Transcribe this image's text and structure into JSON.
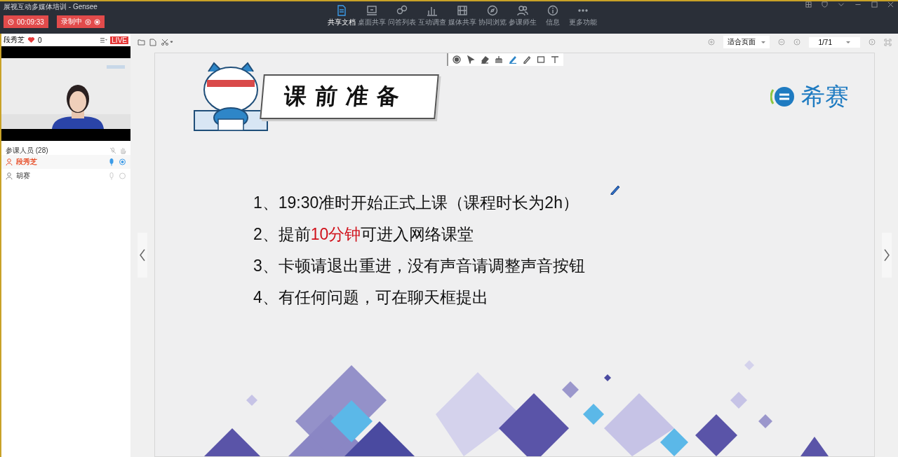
{
  "window": {
    "title": "展视互动多媒体培训  - Gensee"
  },
  "timer": {
    "time": "00:09:33"
  },
  "recording": {
    "label": "录制中"
  },
  "nav": [
    {
      "kind": "doc",
      "label": "共享文档",
      "selected": true
    },
    {
      "kind": "desktop",
      "label": "桌面共享",
      "selected": false
    },
    {
      "kind": "qa",
      "label": "问答列表",
      "selected": false
    },
    {
      "kind": "chart",
      "label": "互动调查",
      "selected": false
    },
    {
      "kind": "media",
      "label": "媒体共享",
      "selected": false
    },
    {
      "kind": "browse",
      "label": "协同浏览",
      "selected": false
    },
    {
      "kind": "people",
      "label": "参课师生",
      "selected": false
    },
    {
      "kind": "info",
      "label": "信息",
      "selected": false
    },
    {
      "kind": "more",
      "label": "更多功能",
      "selected": false
    }
  ],
  "presenter": {
    "name": "段秀芝",
    "likes": "0",
    "live": "LIVE"
  },
  "participants": {
    "header": "参课人员 (28)",
    "rows": [
      {
        "name": "段秀芝",
        "selected": true,
        "mic_on": true,
        "camera_on": true
      },
      {
        "name": "胡赛",
        "selected": false,
        "mic_on": false,
        "camera_on": false
      }
    ]
  },
  "viewer": {
    "fit": "适合页面",
    "page": "1/71"
  },
  "draw_tools": [
    {
      "kind": "record",
      "selected": false
    },
    {
      "kind": "pointer",
      "selected": false
    },
    {
      "kind": "eraser",
      "selected": false
    },
    {
      "kind": "clear",
      "selected": false
    },
    {
      "kind": "pen",
      "selected": true
    },
    {
      "kind": "pencil",
      "selected": false
    },
    {
      "kind": "rect",
      "selected": false
    },
    {
      "kind": "text",
      "selected": false
    }
  ],
  "slide": {
    "title": "课前准备",
    "brand": "希赛",
    "lines": [
      [
        {
          "text": "1、19:30准时开始正式上课（课程时长为2h）",
          "highlight": false
        }
      ],
      [
        {
          "text": "2、提前",
          "highlight": false
        },
        {
          "text": "10分钟",
          "highlight": true
        },
        {
          "text": "可进入网络课堂",
          "highlight": false
        }
      ],
      [
        {
          "text": "3、卡顿请退出重进，没有声音请调整声音按钮",
          "highlight": false
        }
      ],
      [
        {
          "text": "4、有任何问题，可在聊天框提出",
          "highlight": false
        }
      ]
    ]
  }
}
